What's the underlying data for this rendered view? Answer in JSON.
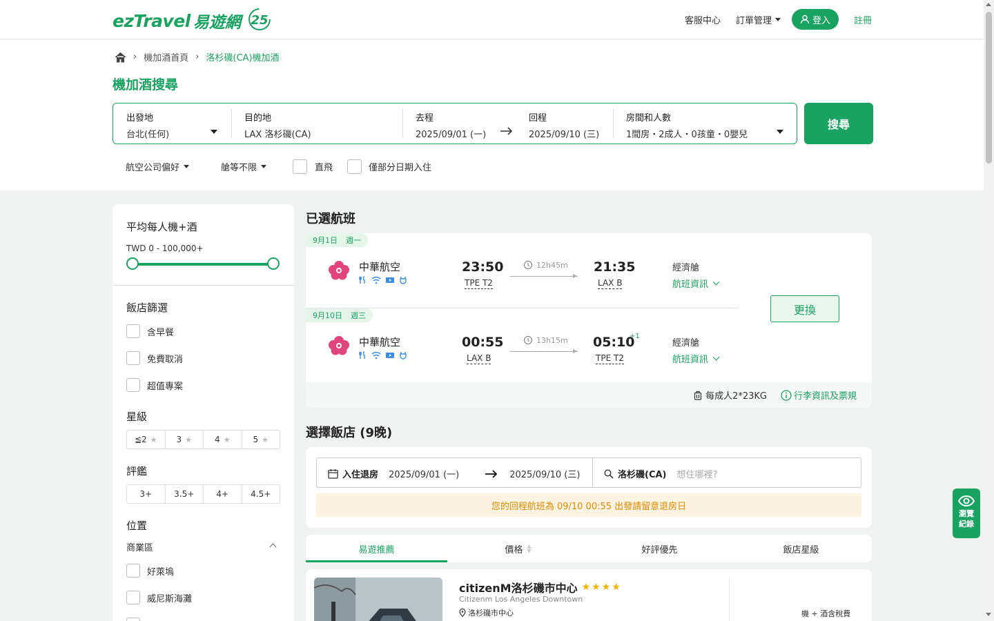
{
  "header": {
    "logo_text": "ezTravel",
    "logo_cn": "易遊網",
    "logo_badge": "25",
    "customer_service": "客服中心",
    "order_management": "訂單管理",
    "login": "登入",
    "register": "註冊"
  },
  "breadcrumb": {
    "home_icon": "home-icon",
    "items": [
      "機加酒首頁",
      "洛杉磯(CA)機加酒"
    ]
  },
  "search": {
    "title": "機加酒搜尋",
    "origin_label": "出發地",
    "origin_value": "台北(任何)",
    "destination_label": "目的地",
    "destination_value": "LAX 洛杉磯(CA)",
    "depart_label": "去程",
    "depart_value": "2025/09/01 (一)",
    "return_label": "回程",
    "return_value": "2025/09/10 (三)",
    "rooms_label": "房間和人數",
    "rooms_value": "1間房・2成人・0孩童・0嬰兒",
    "button": "搜尋"
  },
  "filters": {
    "airline_pref": "航空公司偏好",
    "cabin": "艙等不限",
    "direct": "直飛",
    "partial_dates": "僅部分日期入住"
  },
  "sidebar": {
    "price_title": "平均每人機+酒",
    "price_range": "TWD 0 - 100,000+",
    "price_min_fraction": 0,
    "price_max_fraction": 1,
    "hotel_filter_title": "飯店篩選",
    "hotel_filters": [
      "含早餐",
      "免費取消",
      "超值專案"
    ],
    "star_title": "星級",
    "star_options": [
      "≦2",
      "3",
      "4",
      "5"
    ],
    "rating_title": "評鑑",
    "rating_options": [
      "3+",
      "3.5+",
      "4+",
      "4.5+"
    ],
    "location_title": "位置",
    "location_group": "商業區",
    "locations": [
      "好萊塢",
      "威尼斯海灘"
    ]
  },
  "selected_flights": {
    "title": "已選航班",
    "outbound": {
      "date": "9月1日",
      "weekday": "週一",
      "airline": "中華航空",
      "depart_time": "23:50",
      "depart_airport": "TPE T2",
      "duration": "12h45m",
      "arrive_time": "21:35",
      "arrive_airport": "LAX B",
      "day_offset": "",
      "cabin": "經濟艙",
      "info": "航班資訊"
    },
    "inbound": {
      "date": "9月10日",
      "weekday": "週三",
      "airline": "中華航空",
      "depart_time": "00:55",
      "depart_airport": "LAX B",
      "duration": "13h15m",
      "arrive_time": "05:10",
      "arrive_airport": "TPE T2",
      "day_offset": "+1",
      "cabin": "經濟艙",
      "info": "航班資訊"
    },
    "change_button": "更換",
    "baggage": "每成人2*23KG",
    "baggage_rules": "行李資訊及票規"
  },
  "hotel_section": {
    "title": "選擇飯店 (9晚)",
    "checkin_label": "入住退房",
    "checkin": "2025/09/01 (一)",
    "checkout": "2025/09/10 (三)",
    "city": "洛杉磯(CA)",
    "search_placeholder": "想住哪裡?",
    "warning": "您的回程航班為 09/10 00:55 出發請留意退房日"
  },
  "sort_tabs": [
    "易遊推薦",
    "價格",
    "好評優先",
    "飯店星級"
  ],
  "hotel": {
    "name": "citizenM洛杉磯市中心",
    "stars": "★★★★",
    "english_name": "Citizenm Los Angeles Downtown",
    "location": "洛杉磯市中心",
    "price_note": "機 + 酒含稅費"
  },
  "history_button": {
    "line1": "瀏覽",
    "line2": "紀錄"
  },
  "colors": {
    "brand": "#1aa260",
    "warning_bg": "#fdf3e1",
    "warning_text": "#e08a00"
  }
}
